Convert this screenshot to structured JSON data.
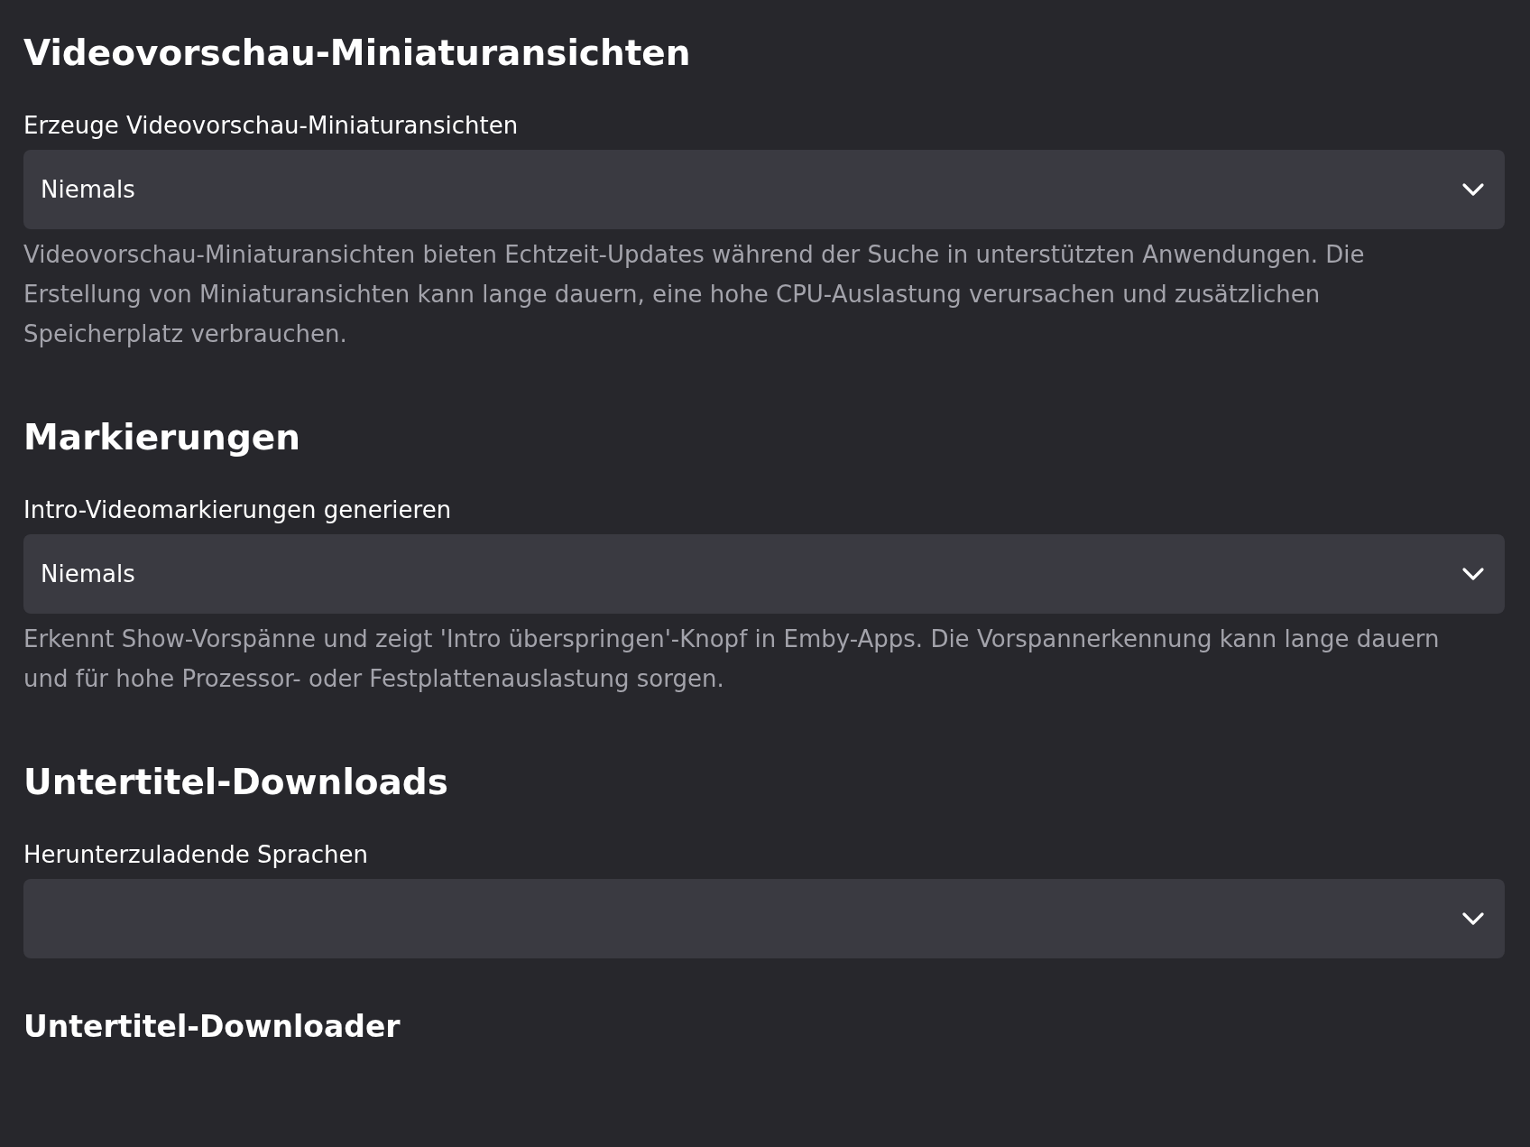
{
  "items": [
    {
      "kind": "heading",
      "text": "Videovorschau-Miniaturansichten"
    },
    {
      "kind": "select",
      "label": "Erzeuge Videovorschau-Miniaturansichten",
      "value": "Niemals",
      "description": "Videovorschau-Miniaturansichten bieten Echtzeit-Updates während der Suche in unterstützten Anwendungen. Die Erstellung von Miniaturansichten kann lange dauern, eine hohe CPU-Auslastung verursachen und zusätzlichen Speicherplatz verbrauchen."
    },
    {
      "kind": "heading",
      "text": "Markierungen"
    },
    {
      "kind": "select",
      "label": "Intro-Videomarkierungen generieren",
      "value": "Niemals",
      "description": "Erkennt Show-Vorspänne und zeigt 'Intro überspringen'-Knopf in Emby-Apps. Die Vorspannerkennung kann lange dauern und für hohe Prozessor- oder Festplattenauslastung sorgen."
    },
    {
      "kind": "heading",
      "text": "Untertitel-Downloads"
    },
    {
      "kind": "select",
      "label": "Herunterzuladende Sprachen"
    },
    {
      "kind": "subheading",
      "text": "Untertitel-Downloader"
    }
  ]
}
